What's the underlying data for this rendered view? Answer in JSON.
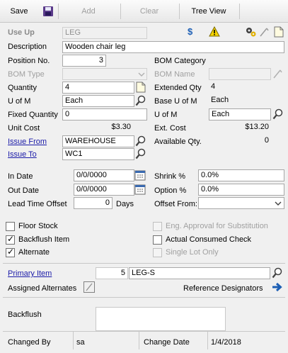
{
  "toolbar": {
    "save": "Save",
    "add": "Add",
    "clear": "Clear",
    "tree_view": "Tree View"
  },
  "header": {
    "use_up_label": "Use Up",
    "use_up_value": "LEG",
    "description_label": "Description",
    "description_value": "Wooden chair leg"
  },
  "left": {
    "position_label": "Position No.",
    "position_value": "3",
    "bom_type_label": "BOM Type",
    "quantity_label": "Quantity",
    "quantity_value": "4",
    "uofm_label": "U of M",
    "uofm_value": "Each",
    "fixed_qty_label": "Fixed Quantity",
    "fixed_qty_value": "0",
    "unit_cost_label": "Unit Cost",
    "unit_cost_value": "$3.30",
    "issue_from_label": "Issue From",
    "issue_from_value": "WAREHOUSE",
    "issue_to_label": "Issue To",
    "issue_to_value": "WC1"
  },
  "right": {
    "bom_category_label": "BOM Category",
    "bom_name_label": "BOM Name",
    "ext_qty_label": "Extended Qty",
    "ext_qty_value": "4",
    "base_uofm_label": "Base U of M",
    "base_uofm_value": "Each",
    "uofm_label": "U of M",
    "uofm_value": "Each",
    "ext_cost_label": "Ext. Cost",
    "ext_cost_value": "$13.20",
    "avail_qty_label": "Available Qty.",
    "avail_qty_value": "0"
  },
  "dates": {
    "in_date_label": "In Date",
    "in_date_value": "0/0/0000",
    "out_date_label": "Out Date",
    "out_date_value": "0/0/0000",
    "lead_time_label": "Lead Time Offset",
    "lead_time_value": "0",
    "days_label": "Days",
    "shrink_label": "Shrink %",
    "shrink_value": "0.0%",
    "option_label": "Option %",
    "option_value": "0.0%",
    "offset_from_label": "Offset From:",
    "offset_from_value": ""
  },
  "checks": {
    "floor_stock": "Floor Stock",
    "floor_stock_checked": false,
    "backflush_item": "Backflush Item",
    "backflush_item_checked": true,
    "alternate": "Alternate",
    "alternate_checked": true,
    "eng_approval": "Eng. Approval for Substitution",
    "actual_consumed": "Actual Consumed Check",
    "actual_consumed_checked": false,
    "single_lot": "Single Lot Only"
  },
  "primary": {
    "label": "Primary Item",
    "number": "5",
    "value": "LEG-S",
    "assigned_alternates": "Assigned Alternates",
    "reference_designators": "Reference Designators"
  },
  "footer": {
    "backflush_label": "Backflush",
    "changed_by_label": "Changed By",
    "changed_by_value": "sa",
    "change_date_label": "Change Date",
    "change_date_value": "1/4/2018"
  }
}
